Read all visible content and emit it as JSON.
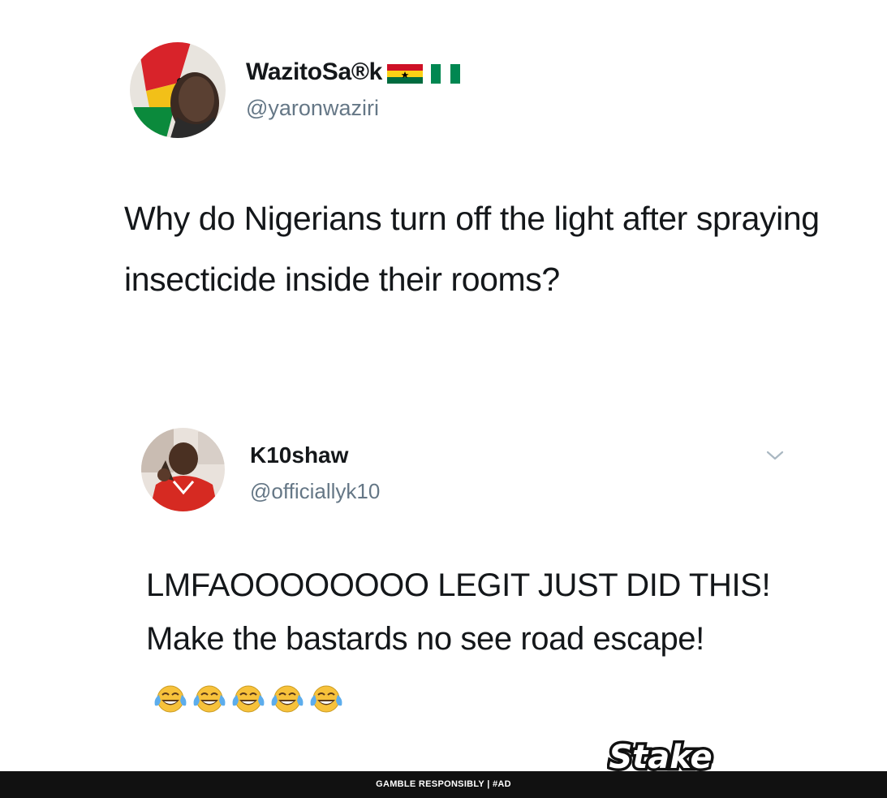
{
  "tweet1": {
    "display_name": "WazitoSa®k",
    "flags": [
      "ghana-flag-icon",
      "nigeria-flag-icon"
    ],
    "handle": "@yaronwaziri",
    "text": "Why do Nigerians turn off the light after spraying insecticide inside their rooms?"
  },
  "tweet2": {
    "display_name": "K10shaw",
    "handle": "@officiallyk10",
    "text": "LMFAOOOOOOOO LEGIT JUST DID THIS! Make the bastards no see road escape!",
    "emoji_name": "face-with-tears-of-joy-icon",
    "emoji_count": 5
  },
  "ad": {
    "disclaimer": "GAMBLE RESPONSIBLY  |  #AD",
    "brand": "Stake"
  },
  "colors": {
    "text_primary": "#14171a",
    "text_secondary": "#657786",
    "bar": "#111111",
    "emoji_yellow": "#f7c23b",
    "tear_blue": "#5dadec"
  }
}
